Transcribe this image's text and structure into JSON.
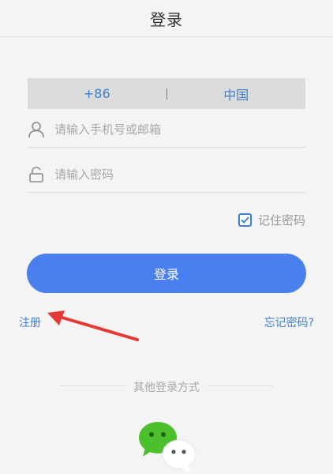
{
  "header": {
    "title": "登录"
  },
  "region": {
    "code": "+86",
    "name": "中国"
  },
  "account": {
    "placeholder": "请输入手机号或邮箱",
    "value": ""
  },
  "password": {
    "placeholder": "请输入密码",
    "value": ""
  },
  "remember": {
    "label": "记住密码",
    "checked": true
  },
  "login_button": {
    "label": "登录"
  },
  "links": {
    "register": "注册",
    "forgot": "忘记密码?"
  },
  "other_login": {
    "label": "其他登录方式",
    "methods": [
      "wechat-icon"
    ]
  },
  "colors": {
    "accent": "#4a7ff0",
    "link": "#3b7fd6",
    "arrow": "#e53935",
    "wechat_green": "#4cbf2d",
    "background": "#f4f4f4"
  }
}
